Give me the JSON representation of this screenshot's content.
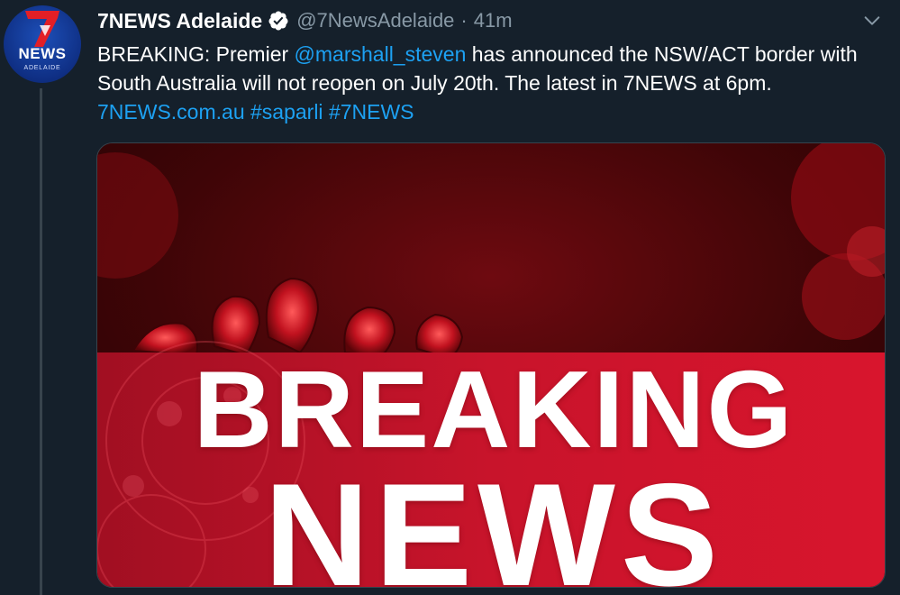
{
  "account": {
    "display_name": "7NEWS Adelaide",
    "handle": "@7NewsAdelaide",
    "separator": "·",
    "time_ago": "41m",
    "verified": true,
    "avatar": {
      "logo_text": "NEWS",
      "city_text": "ADELAIDE",
      "icon": "seven-logo-icon"
    }
  },
  "tweet": {
    "segments": [
      {
        "text": "BREAKING: Premier ",
        "type": "text"
      },
      {
        "text": "@marshall_steven",
        "type": "mention"
      },
      {
        "text": " has announced the NSW/ACT border with South Australia will not reopen on July 20th. The latest in 7NEWS at 6pm. ",
        "type": "text"
      },
      {
        "text": "7NEWS.com.au",
        "type": "link"
      },
      {
        "text": " ",
        "type": "text"
      },
      {
        "text": "#saparli",
        "type": "hashtag"
      },
      {
        "text": " ",
        "type": "text"
      },
      {
        "text": "#7NEWS",
        "type": "hashtag"
      }
    ]
  },
  "media": {
    "headline_line1": "BREAKING",
    "headline_line2": "NEWS"
  },
  "icons": {
    "verified": "verified-badge-icon",
    "menu": "chevron-down-icon"
  },
  "colors": {
    "background": "#15202b",
    "link": "#1da1f2",
    "muted": "#8899a6",
    "thread_line": "#38444d",
    "banner_red": "#d0142c"
  }
}
